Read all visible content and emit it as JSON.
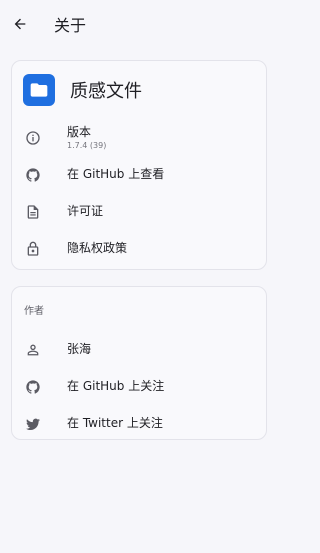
{
  "appbar": {
    "title": "关于"
  },
  "app": {
    "name": "质感文件"
  },
  "app_items": [
    {
      "label": "版本",
      "sub": "1.7.4 (39)",
      "icon": "info-icon"
    },
    {
      "label": "在 GitHub 上查看",
      "icon": "github-icon"
    },
    {
      "label": "许可证",
      "icon": "document-icon"
    },
    {
      "label": "隐私权政策",
      "icon": "lock-icon"
    }
  ],
  "author": {
    "header": "作者",
    "items": [
      {
        "label": "张海",
        "icon": "person-icon"
      },
      {
        "label": "在 GitHub 上关注",
        "icon": "github-icon"
      },
      {
        "label": "在 Twitter 上关注",
        "icon": "twitter-icon"
      }
    ]
  },
  "colors": {
    "brand": "#1f6fe0",
    "background": "#f6f6fa",
    "icon": "#5b5b63"
  }
}
